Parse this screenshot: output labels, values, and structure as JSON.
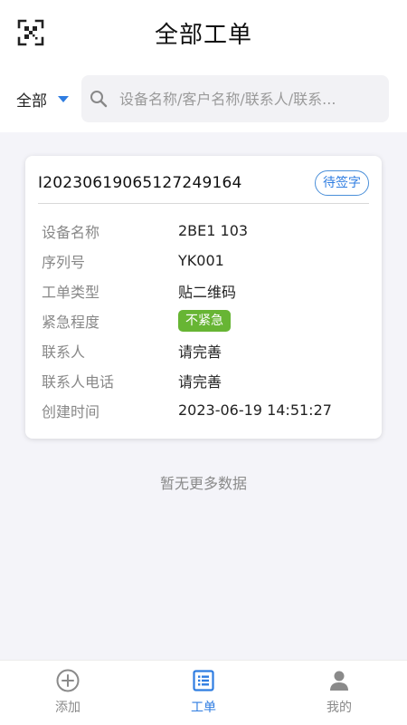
{
  "header": {
    "title": "全部工单",
    "scan_icon": "qr-scan-icon"
  },
  "filter": {
    "selected": "全部",
    "search_placeholder": "设备名称/客户名称/联系人/联系..."
  },
  "work_order": {
    "id": "I20230619065127249164",
    "status": "待签字",
    "fields": [
      {
        "label": "设备名称",
        "value": "2BE1 103"
      },
      {
        "label": "序列号",
        "value": "YK001"
      },
      {
        "label": "工单类型",
        "value": "贴二维码"
      },
      {
        "label": "紧急程度",
        "value": "不紧急"
      },
      {
        "label": "联系人",
        "value": "请完善"
      },
      {
        "label": "联系人电话",
        "value": "请完善"
      },
      {
        "label": "创建时间",
        "value": "2023-06-19 14:51:27"
      }
    ]
  },
  "footer_text": "暂无更多数据",
  "tabs": [
    {
      "label": "添加",
      "icon": "add-circle-icon",
      "active": false
    },
    {
      "label": "工单",
      "icon": "list-icon",
      "active": true
    },
    {
      "label": "我的",
      "icon": "user-icon",
      "active": false
    }
  ],
  "colors": {
    "accent": "#2f7de1",
    "urgency_green": "#67b534"
  }
}
